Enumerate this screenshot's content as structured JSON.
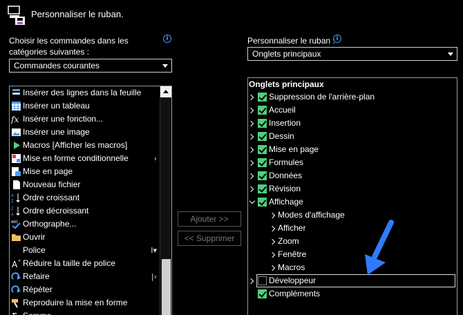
{
  "header": {
    "title": "Personnaliser le ruban."
  },
  "left": {
    "choose_label_line1": "Choisir les commandes dans les",
    "choose_label_line2": "catégories suivantes :",
    "category_value": "Commandes courantes",
    "commands": [
      {
        "label": "Insérer des lignes dans la feuille",
        "icon": "insert-rows-icon",
        "submenu": false
      },
      {
        "label": "Insérer un tableau",
        "icon": "table-icon",
        "submenu": false
      },
      {
        "label": "Insérer une fonction...",
        "icon": "function-fx-icon",
        "submenu": false
      },
      {
        "label": "Insérer une image",
        "icon": "picture-icon",
        "submenu": false
      },
      {
        "label": "Macros [Afficher les macros]",
        "icon": "play-macro-icon",
        "submenu": false
      },
      {
        "label": "Mise en forme conditionnelle",
        "icon": "conditional-format-icon",
        "submenu": true,
        "submenu_glyph": "›"
      },
      {
        "label": "Mise en page",
        "icon": "page-setup-icon",
        "submenu": false
      },
      {
        "label": "Nouveau fichier",
        "icon": "new-file-icon",
        "submenu": false
      },
      {
        "label": "Ordre croissant",
        "icon": "sort-ascending-icon",
        "submenu": false
      },
      {
        "label": "Ordre décroissant",
        "icon": "sort-descending-icon",
        "submenu": false
      },
      {
        "label": "Orthographe...",
        "icon": "spelling-icon",
        "submenu": false
      },
      {
        "label": "Ouvrir",
        "icon": "folder-icon",
        "submenu": false
      },
      {
        "label": "Police",
        "icon": "",
        "submenu": true,
        "submenu_glyph": "I▾"
      },
      {
        "label": "Réduire la taille de police",
        "icon": "decrease-font-icon",
        "submenu": false
      },
      {
        "label": "Refaire",
        "icon": "redo-icon",
        "submenu": true,
        "submenu_glyph": "|›"
      },
      {
        "label": "Répéter",
        "icon": "repeat-icon",
        "submenu": false
      },
      {
        "label": "Reproduire la mise en forme",
        "icon": "format-painter-icon",
        "submenu": false
      },
      {
        "label": "Somme",
        "icon": "sum-icon",
        "submenu": false
      }
    ]
  },
  "middle": {
    "add_label": "Ajouter >>",
    "remove_label": "<< Supprimer"
  },
  "right": {
    "customize_label": "Personnaliser le ruban :",
    "tabs_value": "Onglets principaux",
    "tree_heading": "Onglets principaux",
    "tree": [
      {
        "label": "Suppression de l'arrière-plan",
        "level": 0,
        "expanded": false,
        "checked": true
      },
      {
        "label": "Accueil",
        "level": 0,
        "expanded": false,
        "checked": true
      },
      {
        "label": "Insertion",
        "level": 0,
        "expanded": false,
        "checked": true
      },
      {
        "label": "Dessin",
        "level": 0,
        "expanded": false,
        "checked": true
      },
      {
        "label": "Mise en page",
        "level": 0,
        "expanded": false,
        "checked": true
      },
      {
        "label": "Formules",
        "level": 0,
        "expanded": false,
        "checked": true
      },
      {
        "label": "Données",
        "level": 0,
        "expanded": false,
        "checked": true
      },
      {
        "label": "Révision",
        "level": 0,
        "expanded": false,
        "checked": true
      },
      {
        "label": "Affichage",
        "level": 0,
        "expanded": true,
        "checked": true
      },
      {
        "label": "Modes d'affichage",
        "level": 1
      },
      {
        "label": "Afficher",
        "level": 1
      },
      {
        "label": "Zoom",
        "level": 1
      },
      {
        "label": "Fenêtre",
        "level": 1
      },
      {
        "label": "Macros",
        "level": 1
      },
      {
        "label": "Développeur",
        "level": 0,
        "expanded": false,
        "checked": false,
        "focused": true
      },
      {
        "label": "Compléments",
        "level": 0,
        "expanded": null,
        "checked": true
      }
    ]
  },
  "colors": {
    "accent_arrow": "#2f7bff",
    "checkbox_on": "#4fcf7a",
    "info_icon": "#3d9bff"
  }
}
